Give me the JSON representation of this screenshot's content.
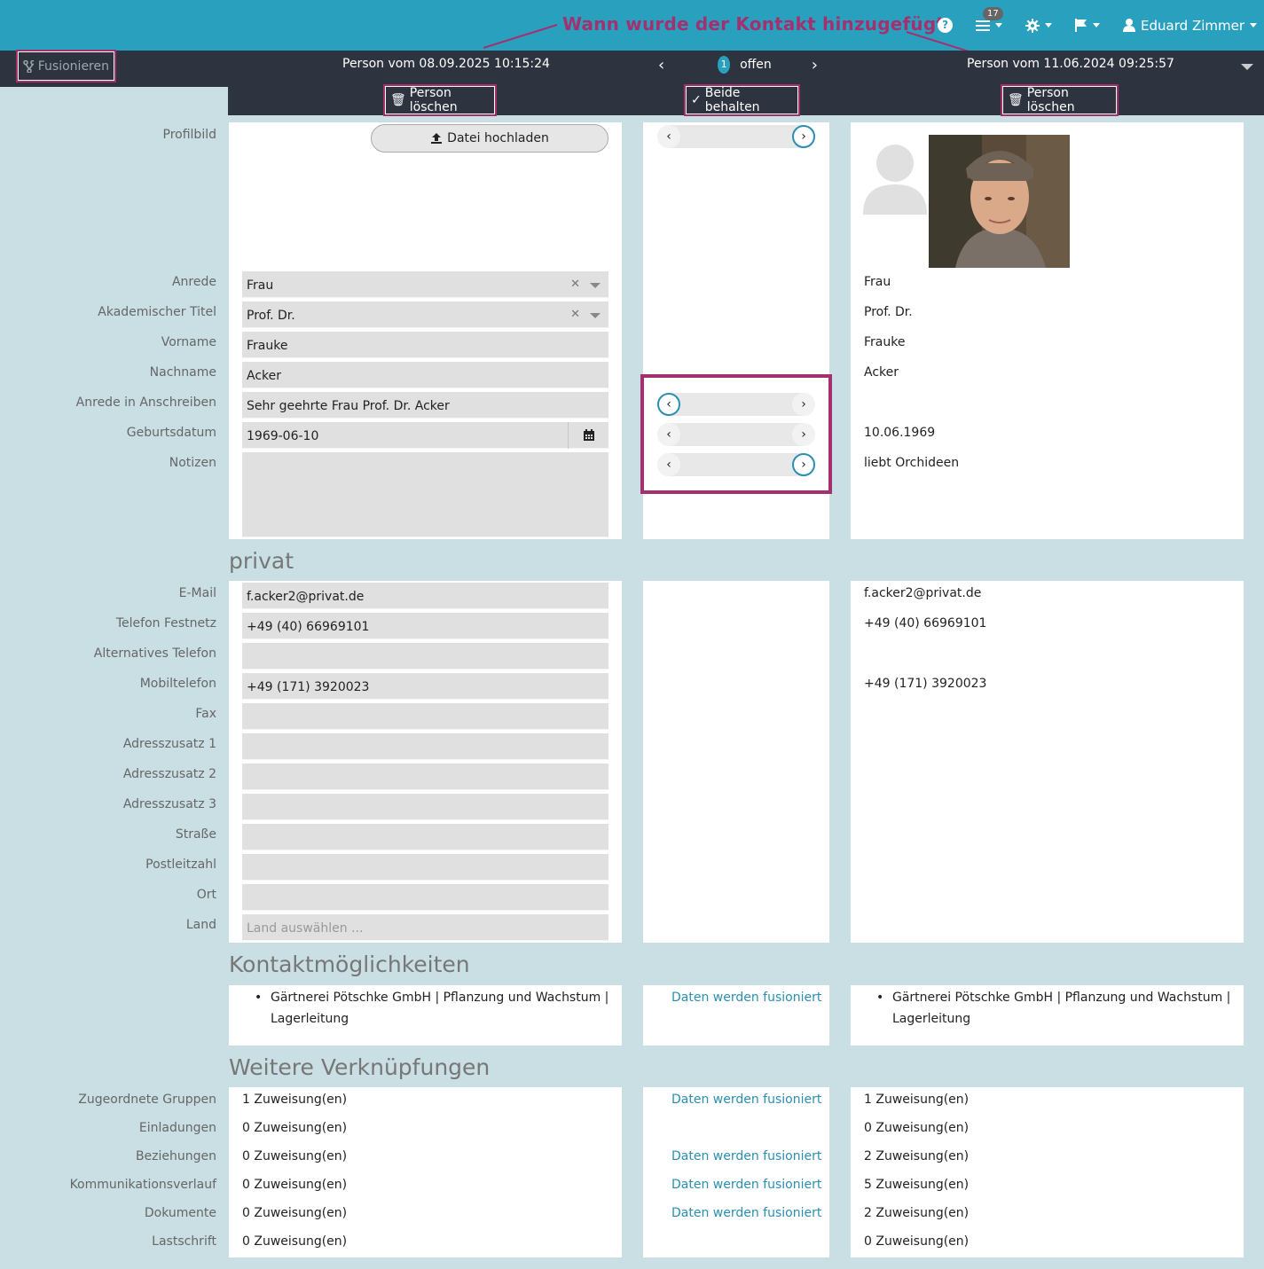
{
  "annotation": "Wann wurde der Kontakt hinzugefügt",
  "topnav": {
    "help": "?",
    "badge": "17",
    "user": "Eduard Zimmer"
  },
  "toolbar": {
    "fusionieren": "Fusionieren",
    "left_header": "Person vom 08.09.2025 10:15:24",
    "right_header": "Person vom 11.06.2024 09:25:57",
    "page_number": "1",
    "page_status": "offen",
    "delete_left": "Person löschen",
    "keep_both": "Beide behalten",
    "delete_right": "Person löschen"
  },
  "profile": {
    "label": "Profilbild",
    "upload": "Datei hochladen"
  },
  "fields": {
    "anrede": {
      "label": "Anrede",
      "left": "Frau",
      "right": "Frau"
    },
    "titel": {
      "label": "Akademischer Titel",
      "left": "Prof. Dr.",
      "right": "Prof. Dr."
    },
    "vorname": {
      "label": "Vorname",
      "left": "Frauke",
      "right": "Frauke"
    },
    "nachname": {
      "label": "Nachname",
      "left": "Acker",
      "right": "Acker"
    },
    "anschreiben": {
      "label": "Anrede in Anschreiben",
      "left": "Sehr geehrte Frau Prof. Dr. Acker",
      "right": ""
    },
    "geburtsdatum": {
      "label": "Geburtsdatum",
      "left": "1969-06-10",
      "right": "10.06.1969"
    },
    "notizen": {
      "label": "Notizen",
      "left": "",
      "right": "liebt Orchideen"
    }
  },
  "privat": {
    "title": "privat",
    "email": {
      "label": "E-Mail",
      "left": "f.acker2@privat.de",
      "right": "f.acker2@privat.de"
    },
    "festnetz": {
      "label": "Telefon Festnetz",
      "left": "+49 (40) 66969101",
      "right": "+49 (40) 66969101"
    },
    "alt_tel": {
      "label": "Alternatives Telefon",
      "left": "",
      "right": ""
    },
    "mobil": {
      "label": "Mobiltelefon",
      "left": "+49 (171) 3920023",
      "right": "+49 (171) 3920023"
    },
    "fax": {
      "label": "Fax"
    },
    "zusatz1": {
      "label": "Adresszusatz 1"
    },
    "zusatz2": {
      "label": "Adresszusatz 2"
    },
    "zusatz3": {
      "label": "Adresszusatz 3"
    },
    "strasse": {
      "label": "Straße"
    },
    "plz": {
      "label": "Postleitzahl"
    },
    "ort": {
      "label": "Ort"
    },
    "land": {
      "label": "Land",
      "placeholder": "Land auswählen ..."
    }
  },
  "kontakt": {
    "title": "Kontaktmöglichkeiten",
    "left_line1": "Gärtnerei Pötschke GmbH | Pflanzung und Wachstum |",
    "left_line2": "Lagerleitung",
    "middle": "Daten werden fusioniert",
    "right_line1": "Gärtnerei Pötschke GmbH | Pflanzung und Wachstum |",
    "right_line2": "Lagerleitung"
  },
  "weitere": {
    "title": "Weitere Verknüpfungen",
    "rows": [
      {
        "label": "Zugeordnete Gruppen",
        "left": "1 Zuweisung(en)",
        "middle": "Daten werden fusioniert",
        "right": "1 Zuweisung(en)"
      },
      {
        "label": "Einladungen",
        "left": "0 Zuweisung(en)",
        "middle": "",
        "right": "0 Zuweisung(en)"
      },
      {
        "label": "Beziehungen",
        "left": "0 Zuweisung(en)",
        "middle": "Daten werden fusioniert",
        "right": "2 Zuweisung(en)"
      },
      {
        "label": "Kommunikationsverlauf",
        "left": "0 Zuweisung(en)",
        "middle": "Daten werden fusioniert",
        "right": "5 Zuweisung(en)"
      },
      {
        "label": "Dokumente",
        "left": "0 Zuweisung(en)",
        "middle": "Daten werden fusioniert",
        "right": "2 Zuweisung(en)"
      },
      {
        "label": "Lastschrift",
        "left": "0 Zuweisung(en)",
        "middle": "",
        "right": "0 Zuweisung(en)"
      }
    ]
  }
}
